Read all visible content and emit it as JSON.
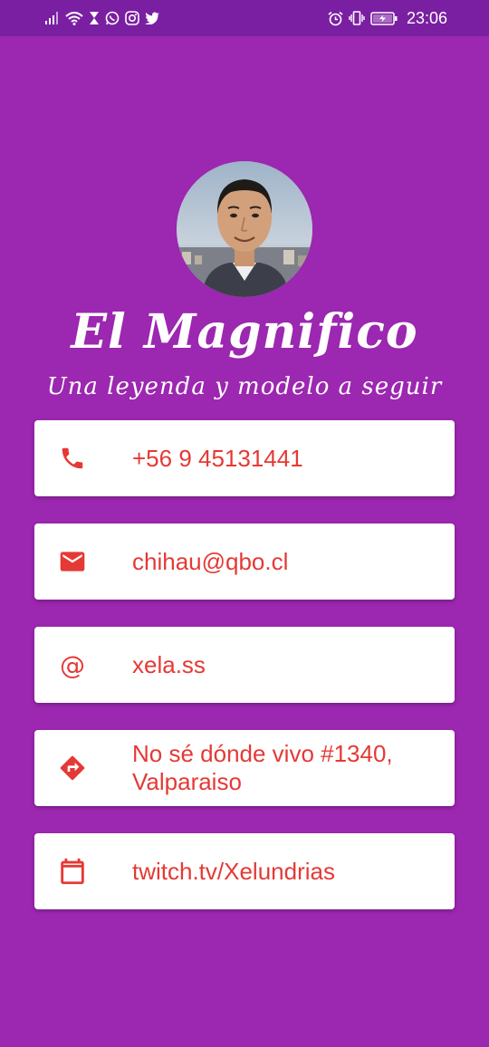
{
  "status_bar": {
    "time": "23:06",
    "left_icons": [
      "signal-icon",
      "wifi-icon",
      "hourglass-icon",
      "whatsapp-icon",
      "instagram-icon",
      "twitter-icon"
    ],
    "right_icons": [
      "alarm-icon",
      "vibrate-icon",
      "battery-icon"
    ]
  },
  "profile": {
    "name": "El Magnifico",
    "tagline": "Una leyenda y modelo a seguir"
  },
  "cards": [
    {
      "icon": "phone-icon",
      "text": "+56 9 45131441"
    },
    {
      "icon": "email-icon",
      "text": "chihau@qbo.cl"
    },
    {
      "icon": "at-icon",
      "symbol": "@",
      "text": "xela.ss"
    },
    {
      "icon": "directions-icon",
      "text": "No sé dónde vivo #1340,\nValparaiso"
    },
    {
      "icon": "calendar-icon",
      "text": "twitch.tv/Xelundrias"
    }
  ],
  "colors": {
    "background": "#9c27b0",
    "status_bar": "#7b1fa2",
    "accent": "#e53935",
    "card": "#ffffff"
  }
}
